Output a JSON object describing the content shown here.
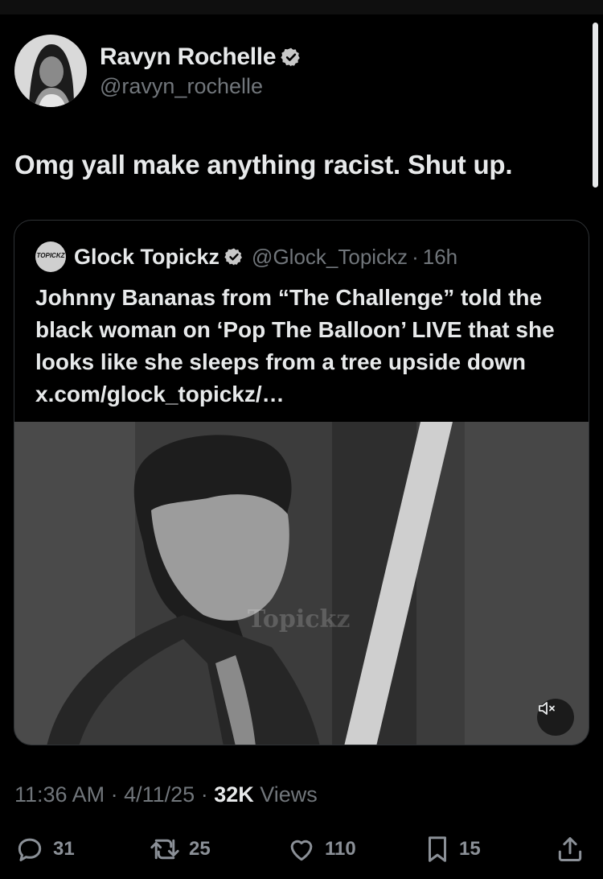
{
  "author": {
    "display_name": "Ravyn Rochelle",
    "handle": "@ravyn_rochelle",
    "verified": true
  },
  "tweet": {
    "text": "Omg yall make anything racist. Shut up.",
    "time": "11:36 AM",
    "date": "4/11/25",
    "views_count": "32K",
    "views_label": "Views"
  },
  "quoted": {
    "display_name": "Glock Topickz",
    "avatar_text": "TOPICKZ",
    "handle": "@Glock_Topickz",
    "separator": "·",
    "time": "16h",
    "text": "Johnny Bananas from “The Challenge” told the black woman on ‘Pop The Balloon’ LIVE that she looks like she sleeps from a tree upside down x.com/glock_topickz/…",
    "media_watermark": "Topickz"
  },
  "actions": {
    "replies": "31",
    "reposts": "25",
    "likes": "110",
    "bookmarks": "15"
  },
  "colors": {
    "background": "#000000",
    "text_primary": "#e7e9ea",
    "text_secondary": "#71767b",
    "border": "#2f3336"
  }
}
